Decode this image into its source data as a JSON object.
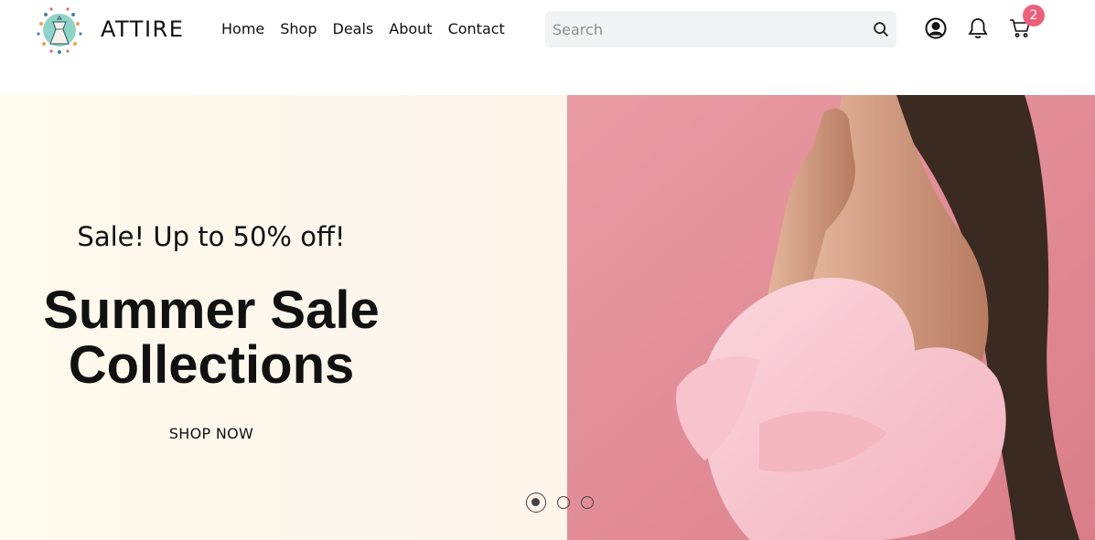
{
  "brand": {
    "name": "ATTIRE",
    "logo_icon": "boutique-dress-logo"
  },
  "nav": {
    "items": [
      {
        "label": "Home"
      },
      {
        "label": "Shop"
      },
      {
        "label": "Deals"
      },
      {
        "label": "About"
      },
      {
        "label": "Contact"
      }
    ]
  },
  "search": {
    "placeholder": "Search",
    "icon": "search-icon"
  },
  "header_icons": {
    "user": "user-icon",
    "bell": "bell-icon",
    "cart": "cart-icon",
    "cart_count": "2"
  },
  "hero": {
    "subtitle": "Sale! Up to 50% off!",
    "title_line1": "Summer Sale",
    "title_line2": "Collections",
    "cta": "SHOP NOW",
    "image": "woman-in-pink-off-shoulder-dress",
    "slides": 3,
    "active_slide": 1
  },
  "colors": {
    "badge": "#ec5f7b",
    "hero_bg": "#fdf7ec",
    "image_bg": "#e89aa3"
  }
}
